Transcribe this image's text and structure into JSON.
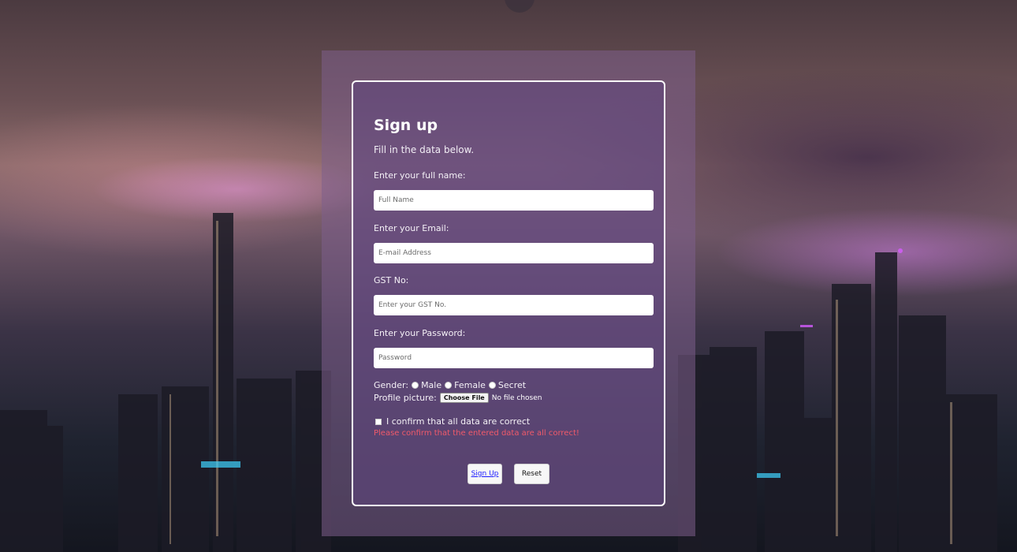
{
  "form": {
    "title": "Sign up",
    "subtitle": "Fill in the data below.",
    "fullname": {
      "label": "Enter your full name:",
      "placeholder": "Full Name"
    },
    "email": {
      "label": "Enter your Email:",
      "placeholder": "E-mail Address"
    },
    "gst": {
      "label": "GST No:",
      "placeholder": "Enter your GST No."
    },
    "password": {
      "label": "Enter your Password:",
      "placeholder": "Password"
    },
    "gender": {
      "label": "Gender:",
      "options": [
        "Male",
        "Female",
        "Secret"
      ]
    },
    "profile": {
      "label": "Profile picture:",
      "button": "Choose File",
      "status": "No file chosen"
    },
    "confirm": {
      "label": "I confirm that all data are correct"
    },
    "error": "Please confirm that the entered data are all correct!",
    "signup_label": "Sign Up",
    "reset_label": "Reset"
  },
  "colors": {
    "error": "#f05a6a",
    "link": "#1a1aff"
  }
}
